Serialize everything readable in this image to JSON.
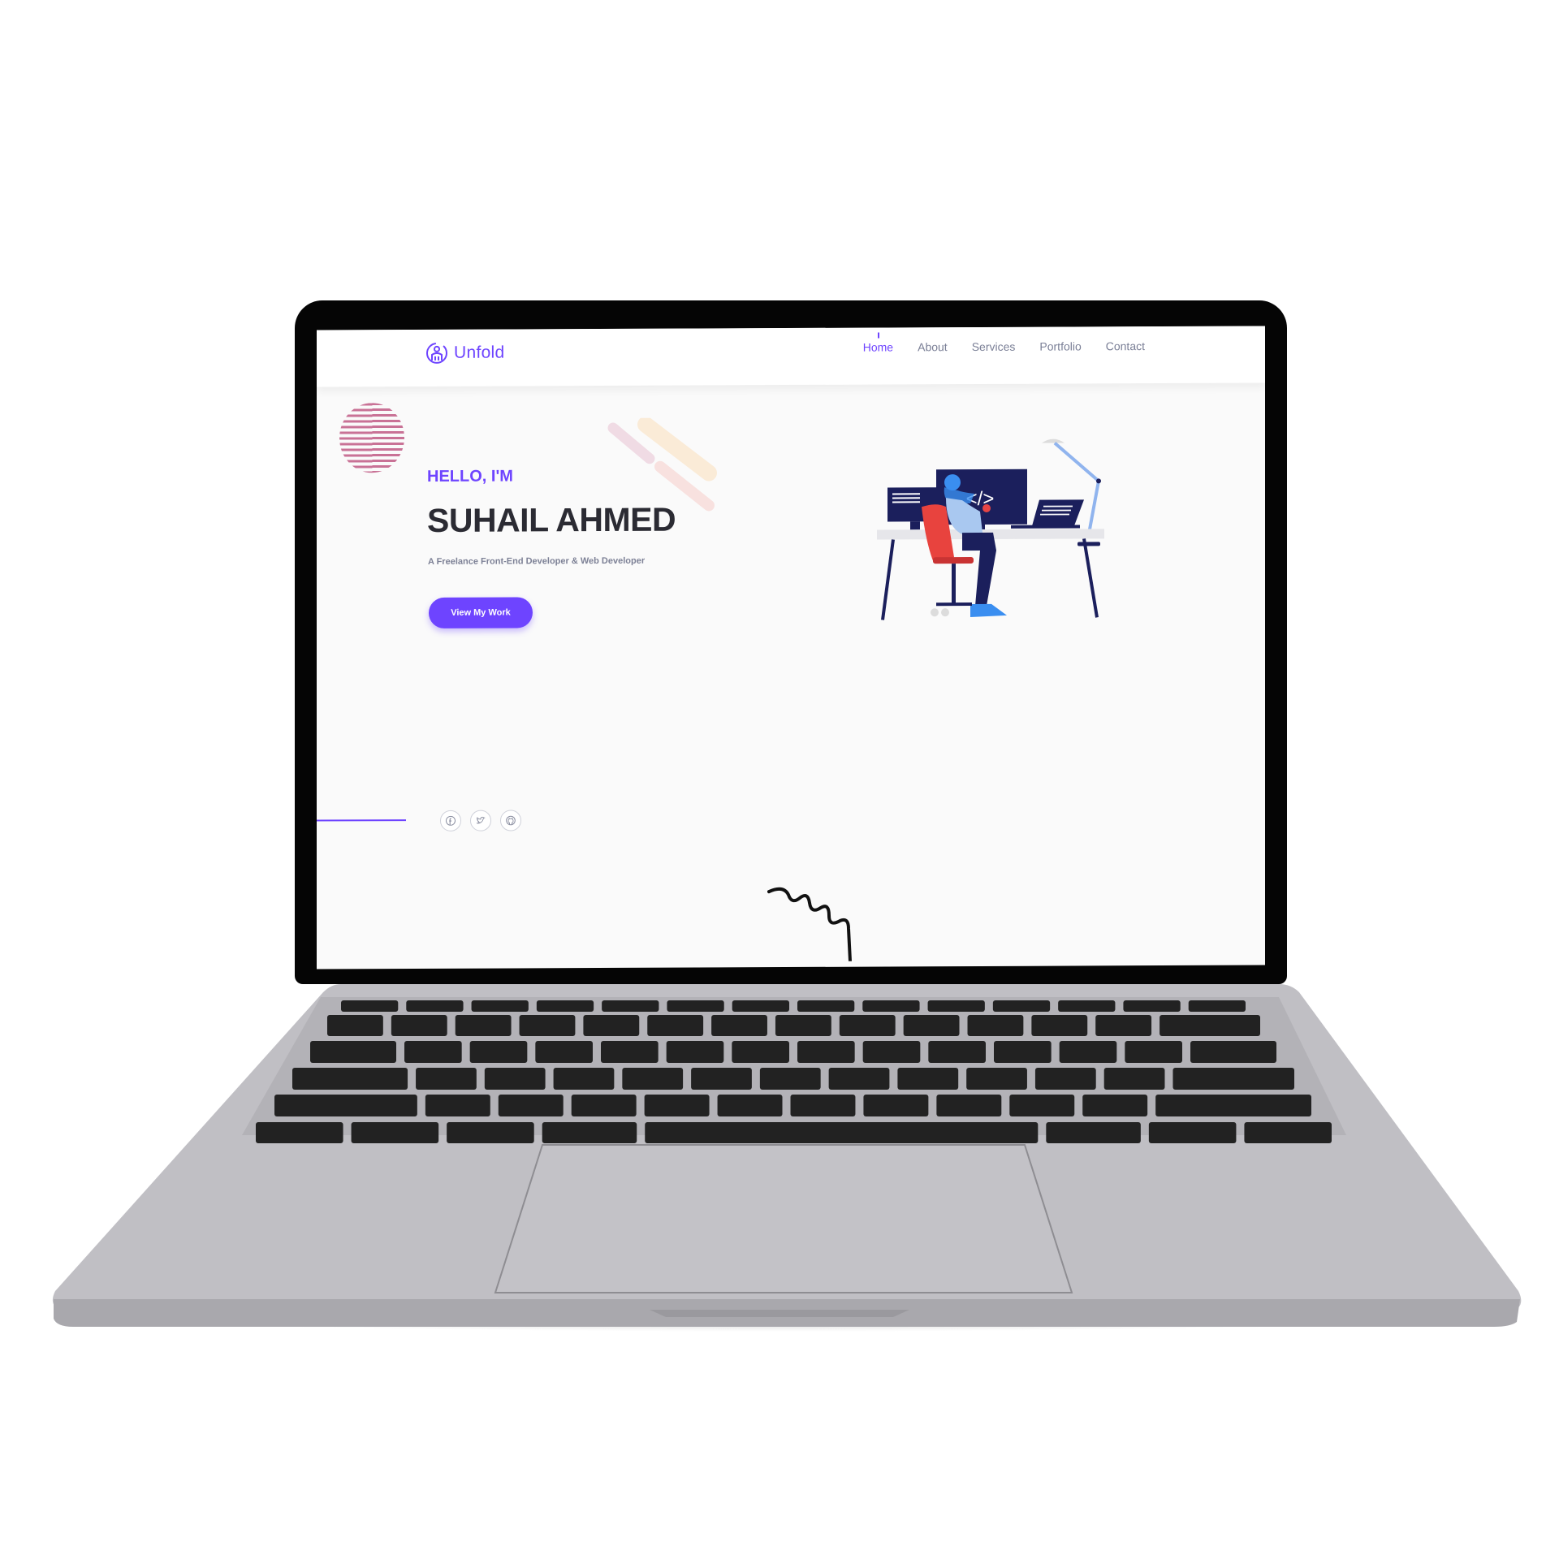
{
  "site": {
    "logo_text": "Unfold",
    "nav": [
      "Home",
      "About",
      "Services",
      "Portfolio",
      "Contact"
    ],
    "active_nav": "Home",
    "accent_color": "#6e44ff"
  },
  "hero": {
    "greeting": "HELLO, I'M",
    "name": "SUHAIL AHMED",
    "tagline": "A Freelance Front-End Developer & Web Developer",
    "cta_label": "View My Work"
  },
  "socials": [
    "facebook-icon",
    "twitter-icon",
    "github-icon"
  ],
  "illustration": {
    "screen_code_glyph": "</>"
  },
  "device": {
    "type": "laptop",
    "body_color": "#c0bfc4",
    "keys_color": "#222222"
  }
}
